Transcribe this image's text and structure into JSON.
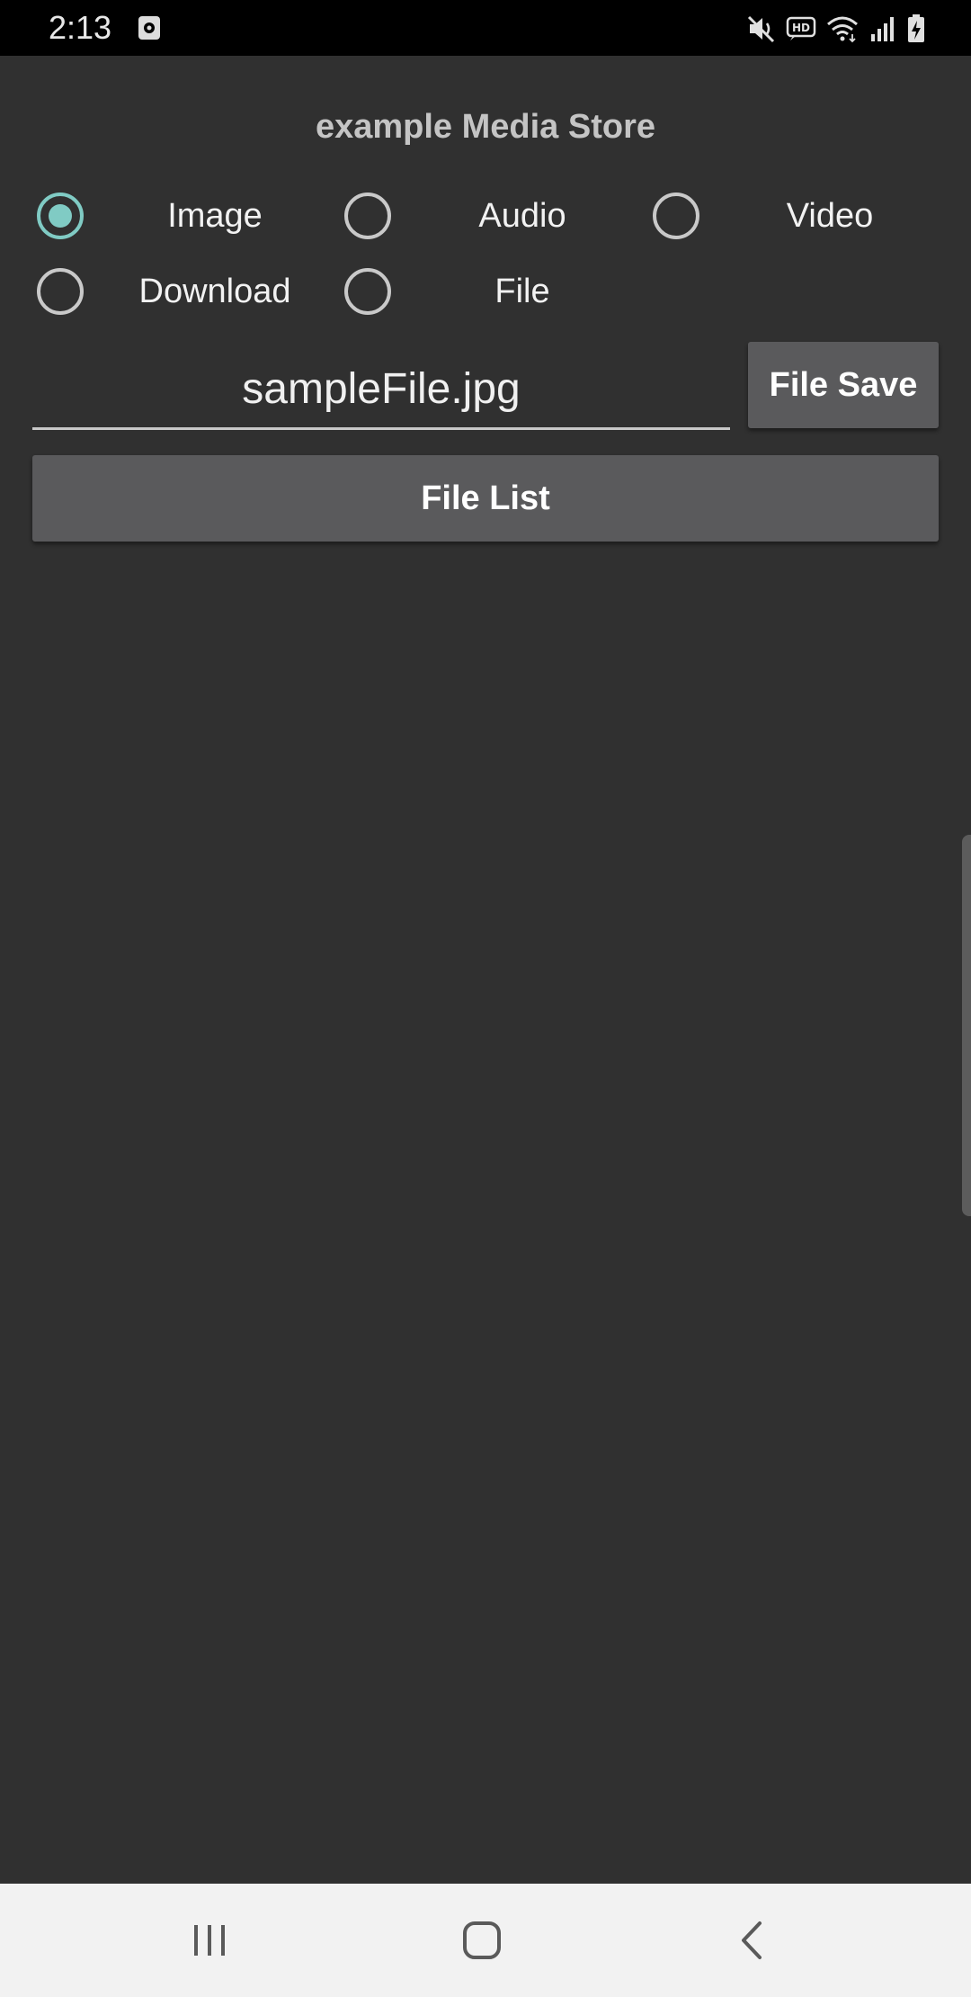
{
  "status_bar": {
    "time": "2:13",
    "left_icons": [
      "screen-recorder-icon"
    ],
    "right_icons": [
      "mute-icon",
      "hd-voice-icon",
      "wifi-icon",
      "signal-icon",
      "battery-charging-icon"
    ]
  },
  "app": {
    "title": "example Media Store",
    "media_types": [
      {
        "label": "Image",
        "checked": true
      },
      {
        "label": "Audio",
        "checked": false
      },
      {
        "label": "Video",
        "checked": false
      },
      {
        "label": "Download",
        "checked": false
      },
      {
        "label": "File",
        "checked": false
      }
    ],
    "filename": {
      "value": "sampleFile.jpg"
    },
    "save_button_label": "File Save",
    "list_button_label": "File List"
  },
  "nav_bar": {
    "buttons": [
      "recents-icon",
      "home-icon",
      "back-icon"
    ]
  },
  "colors": {
    "background": "#303030",
    "accent": "#80cbc4",
    "button": "#5a5a5c",
    "nav_bar": "#f2f2f2"
  }
}
